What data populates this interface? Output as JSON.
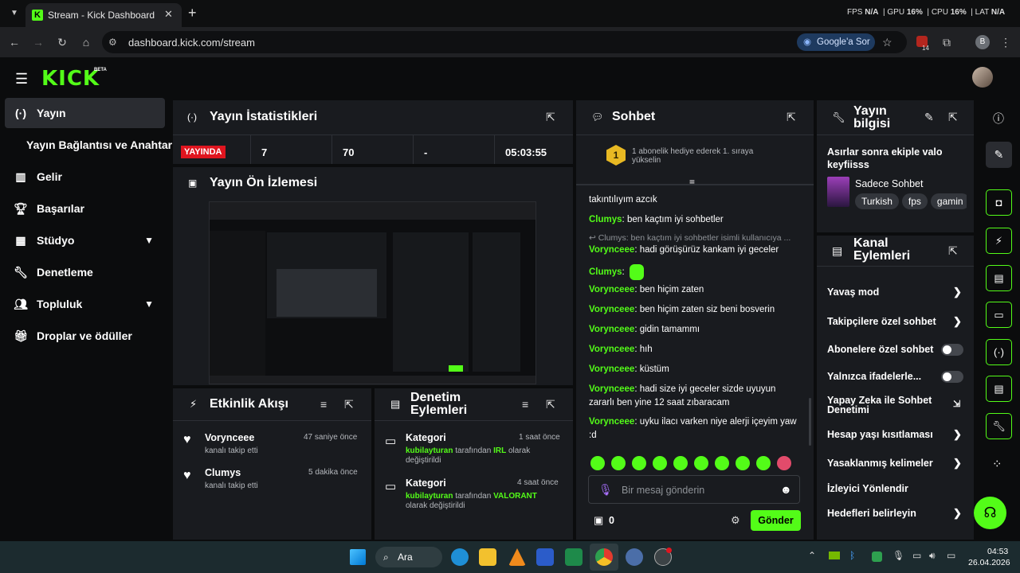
{
  "browser": {
    "tab_title": "Stream - Kick Dashboard",
    "new_tab": "+",
    "url": "dashboard.kick.com/stream",
    "google_ask": "Google'a Sor",
    "fps_label": "FPS",
    "fps_value": "N/A",
    "gpu_label": "GPU",
    "gpu_value": "16%",
    "cpu_label": "CPU",
    "cpu_value": "16%",
    "lat_label": "LAT",
    "lat_value": "N/A",
    "extension_badge": "14",
    "profile_letter": "B"
  },
  "header": {
    "logo": "KICK",
    "beta": "BETA"
  },
  "sidebar": {
    "items": [
      {
        "label": "Yayın",
        "icon": "broadcast-icon"
      },
      {
        "label": "Yayın Bağlantısı ve Anahtarı"
      },
      {
        "label": "Gelir",
        "icon": "chart-icon"
      },
      {
        "label": "Başarılar",
        "icon": "trophy-icon"
      },
      {
        "label": "Stüdyo",
        "icon": "studio-icon"
      },
      {
        "label": "Denetleme",
        "icon": "wrench-icon"
      },
      {
        "label": "Topluluk",
        "icon": "people-icon"
      },
      {
        "label": "Droplar ve ödüller",
        "icon": "gift-icon"
      }
    ]
  },
  "stats": {
    "title": "Yayın İstatistikleri",
    "live": "YAYINDA",
    "viewers": "7",
    "followers": "70",
    "dash": "-",
    "uptime": "05:03:55"
  },
  "preview": {
    "title": "Yayın Ön İzlemesi"
  },
  "activity": {
    "title": "Etkinlik Akışı",
    "items": [
      {
        "user": "Vorynceee",
        "action": "kanalı takip etti",
        "time": "47 saniye önce"
      },
      {
        "user": "Clumys",
        "action": "kanalı takip etti",
        "time": "5 dakika önce"
      }
    ]
  },
  "modactions": {
    "title": "Denetim Eylemleri",
    "items": [
      {
        "title": "Kategori",
        "time": "1 saat önce",
        "user": "kubilayturan",
        "text1": "tarafından",
        "value": "IRL",
        "text2": "olarak değiştirildi"
      },
      {
        "title": "Kategori",
        "time": "4 saat önce",
        "user": "kubilayturan",
        "text1": "tarafından",
        "value": "VALORANT",
        "text2": "olarak değiştirildi"
      }
    ]
  },
  "chat": {
    "title": "Sohbet",
    "banner_rank": "1",
    "banner_text": "1 abonelik hediye ederek 1. sıraya yükselin",
    "partial_line": "takıntılıyım azcık",
    "messages": [
      {
        "user": "Clumys",
        "text": "ben kaçtım iyi sohbetler"
      },
      {
        "reply": "Clumys: ben kaçtım iyi sohbetler isimli kullanıcıya ..."
      },
      {
        "user": "Vorynceee",
        "text": "hadi görüşürüz kankam iyi geceler"
      },
      {
        "user": "Clumys",
        "text": ""
      },
      {
        "user": "Vorynceee",
        "text": "ben hiçim zaten"
      },
      {
        "user": "Vorynceee",
        "text": "ben hiçim zaten siz beni bosverin"
      },
      {
        "user": "Vorynceee",
        "text": "gidin tamammı"
      },
      {
        "user": "Vorynceee",
        "text": "hıh"
      },
      {
        "user": "Vorynceee",
        "text": "küstüm"
      },
      {
        "user": "Vorynceee",
        "text": "hadi size iyi geceler sizde uyuyun zararlı ben yine 12 saat zıbaracam"
      },
      {
        "user": "Vorynceee",
        "text": "uyku ilacı varken niye alerji içeyim yaw :d"
      }
    ],
    "placeholder": "Bir mesaj gönderin",
    "points": "0",
    "send": "Gönder"
  },
  "streaminfo": {
    "title": "Yayın bilgisi",
    "stream_title": "Asırlar sonra ekiple valo keyfiisss",
    "category": "Sadece Sohbet",
    "tags": [
      "Turkish",
      "fps",
      "gamin"
    ]
  },
  "channel": {
    "title": "Kanal Eylemleri",
    "rows": [
      {
        "label": "Yavaş mod",
        "kind": "chev"
      },
      {
        "label": "Takipçilere özel sohbet",
        "kind": "chev"
      },
      {
        "label": "Abonelere özel sohbet",
        "kind": "toggle"
      },
      {
        "label": "Yalnızca ifadelerle...",
        "kind": "toggle"
      },
      {
        "label": "Yapay Zeka ile Sohbet Denetimi",
        "kind": "ext"
      },
      {
        "label": "Hesap yaşı kısıtlaması",
        "kind": "chev"
      },
      {
        "label": "Yasaklanmış kelimeler",
        "kind": "chev"
      },
      {
        "label": "İzleyici Yönlendir",
        "kind": "none"
      },
      {
        "label": "Hedefleri belirleyin",
        "kind": "chev"
      }
    ]
  },
  "taskbar": {
    "search": "Ara",
    "time": "04:53",
    "date": "26.04.2026"
  },
  "colors": {
    "accent": "#53fc18",
    "panel": "#191b1f",
    "live": "#e0151f"
  }
}
